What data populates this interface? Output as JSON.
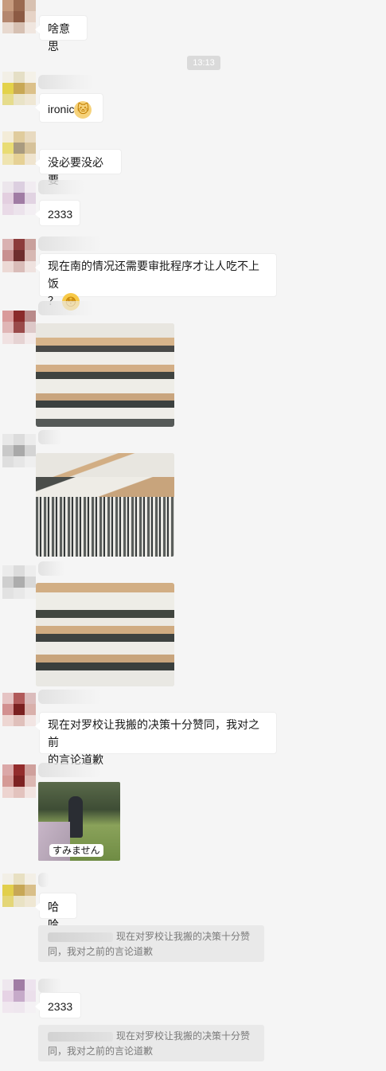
{
  "timestamp": "13:13",
  "messages": [
    {
      "id": "m1",
      "text": "啥意思"
    },
    {
      "id": "m2",
      "text": "ironic",
      "emoji": "cat-face-emoji"
    },
    {
      "id": "m3",
      "text": "没必要没必要"
    },
    {
      "id": "m4",
      "text": "2333"
    },
    {
      "id": "m5",
      "line1": "现在南的情况还需要审批程序才让人吃不上饭",
      "line2": "？",
      "emoji": "flushed-face-emoji"
    },
    {
      "id": "m6",
      "type": "image",
      "icon": "mall-atrium-crowd-photo"
    },
    {
      "id": "m7",
      "type": "image",
      "icon": "mall-atrium-crowd-photo"
    },
    {
      "id": "m8",
      "type": "image",
      "icon": "mall-atrium-crowd-photo"
    },
    {
      "id": "m9",
      "line1": "现在对罗校让我搬的决策十分赞同，我对之前",
      "line2": "的言论道歉"
    },
    {
      "id": "m10",
      "type": "sticker",
      "caption": "すみません"
    },
    {
      "id": "m11",
      "text": "哈哈"
    },
    {
      "id": "m12",
      "text": "2333"
    }
  ],
  "quotes": [
    {
      "line1": "现在对罗校让我搬的决策十分赞",
      "line2": "同，我对之前的言论道歉"
    },
    {
      "line1": "现在对罗校让我搬的决策十分赞",
      "line2": "同，我对之前的言论道歉"
    }
  ],
  "colors": {
    "background": "#f5f5f5",
    "bubble": "#ffffff",
    "quote": "#e9e9e9",
    "timestamp_bg": "#dadada"
  }
}
